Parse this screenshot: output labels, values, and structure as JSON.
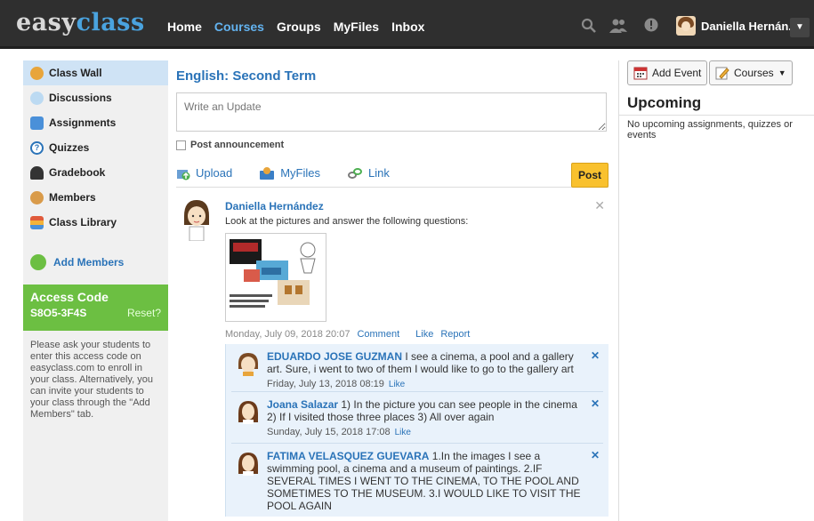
{
  "topbar": {
    "logo_part1": "easy",
    "logo_part2": "class",
    "nav": [
      "Home",
      "Courses",
      "Groups",
      "MyFiles",
      "Inbox"
    ],
    "active_nav": "Courses",
    "user_name": "Daniella Hernán..."
  },
  "sidebar": {
    "items": [
      {
        "label": "Class Wall",
        "icon": "class-wall-icon",
        "selected": true
      },
      {
        "label": "Discussions",
        "icon": "discussions-icon"
      },
      {
        "label": "Assignments",
        "icon": "assignments-icon"
      },
      {
        "label": "Quizzes",
        "icon": "quizzes-icon"
      },
      {
        "label": "Gradebook",
        "icon": "gradebook-icon"
      },
      {
        "label": "Members",
        "icon": "members-icon"
      },
      {
        "label": "Class Library",
        "icon": "class-library-icon"
      }
    ],
    "add_members": "Add Members",
    "access_code_title": "Access Code",
    "access_code": "S8O5-3F4S",
    "reset": "Reset?",
    "help_text": "Please ask your students to enter this access code on easyclass.com to enroll in your class. Alternatively, you can invite your students to your class through the \"Add Members\" tab."
  },
  "main": {
    "title": "English: Second Term",
    "write_placeholder": "Write an Update",
    "post_announcement": "Post announcement",
    "actions": {
      "upload": "Upload",
      "myfiles": "MyFiles",
      "link": "Link"
    },
    "post_button": "Post",
    "post": {
      "author": "Daniella Hernández",
      "text": "Look at the pictures and answer the following questions:",
      "date": "Monday, July 09, 2018 20:07",
      "comment": "Comment",
      "like": "Like",
      "report": "Report",
      "comments": [
        {
          "name": "EDUARDO JOSE GUZMAN",
          "text": " I see a cinema, a pool and a gallery art. Sure, i went to two of them I would like to go to the gallery art",
          "date": "Friday, July 13, 2018 08:19",
          "like": "Like"
        },
        {
          "name": "Joana Salazar",
          "text": " 1) In the picture you can see people in the cinema 2) If I visited those three places 3) All over again",
          "date": "Sunday, July 15, 2018 17:08",
          "like": "Like"
        },
        {
          "name": "FATIMA VELASQUEZ GUEVARA",
          "text": " 1.In the images I see a swimming pool, a cinema and a museum of paintings. 2.IF SEVERAL TIMES I WENT TO THE CINEMA, TO THE POOL AND SOMETIMES TO THE MUSEUM. 3.I WOULD LIKE TO VISIT THE POOL AGAIN",
          "date": "",
          "like": ""
        }
      ]
    }
  },
  "right": {
    "add_event": "Add Event",
    "courses": "Courses",
    "upcoming_title": "Upcoming",
    "upcoming_text": "No upcoming assignments, quizzes or events"
  },
  "colors": {
    "brand_blue": "#2a73b8",
    "access_green": "#6cbf42",
    "post_yellow": "#f9c12e",
    "topbar": "#2f2f2f"
  }
}
